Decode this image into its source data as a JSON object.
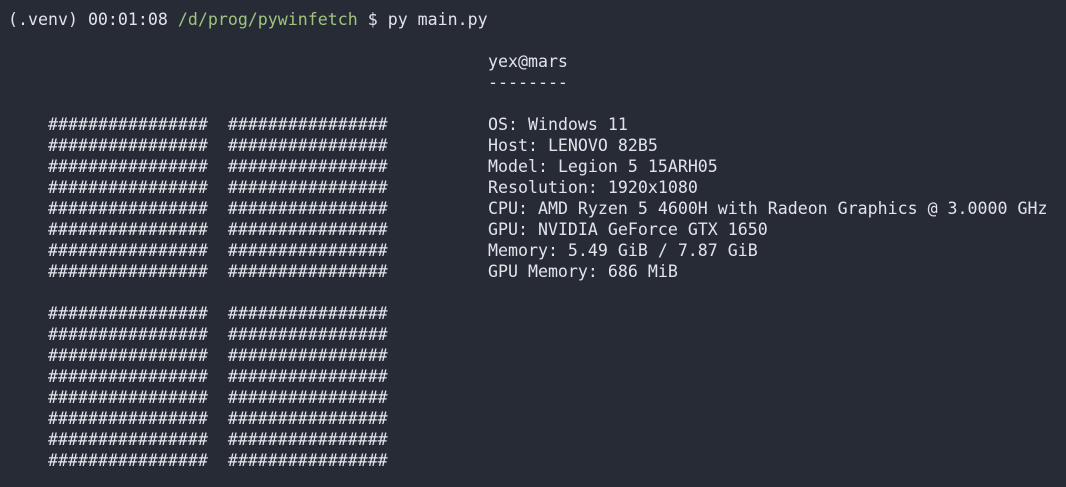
{
  "prompt": {
    "venv": "(.venv)",
    "time": "00:01:08",
    "path": "/d/prog/pywinfetch",
    "symbol": "$",
    "command": "py main.py"
  },
  "logo": {
    "row": "################  ################",
    "rows_per_block": 8,
    "blocks": 2
  },
  "info": {
    "user_host": "yex@mars",
    "separator": "--------",
    "fields": [
      {
        "label": "OS:",
        "value": "Windows 11"
      },
      {
        "label": "Host:",
        "value": "LENOVO 82B5"
      },
      {
        "label": "Model:",
        "value": "Legion 5 15ARH05"
      },
      {
        "label": "Resolution:",
        "value": "1920x1080"
      },
      {
        "label": "CPU:",
        "value": "AMD Ryzen 5 4600H with Radeon Graphics @ 3.0000 GHz"
      },
      {
        "label": "GPU:",
        "value": "NVIDIA GeForce GTX 1650"
      },
      {
        "label": "Memory:",
        "value": "5.49 GiB / 7.87 GiB"
      },
      {
        "label": "GPU Memory:",
        "value": "686 MiB"
      }
    ]
  },
  "colors": {
    "background": "#272b35",
    "text": "#e2e4ea",
    "path": "#9fc47e"
  }
}
